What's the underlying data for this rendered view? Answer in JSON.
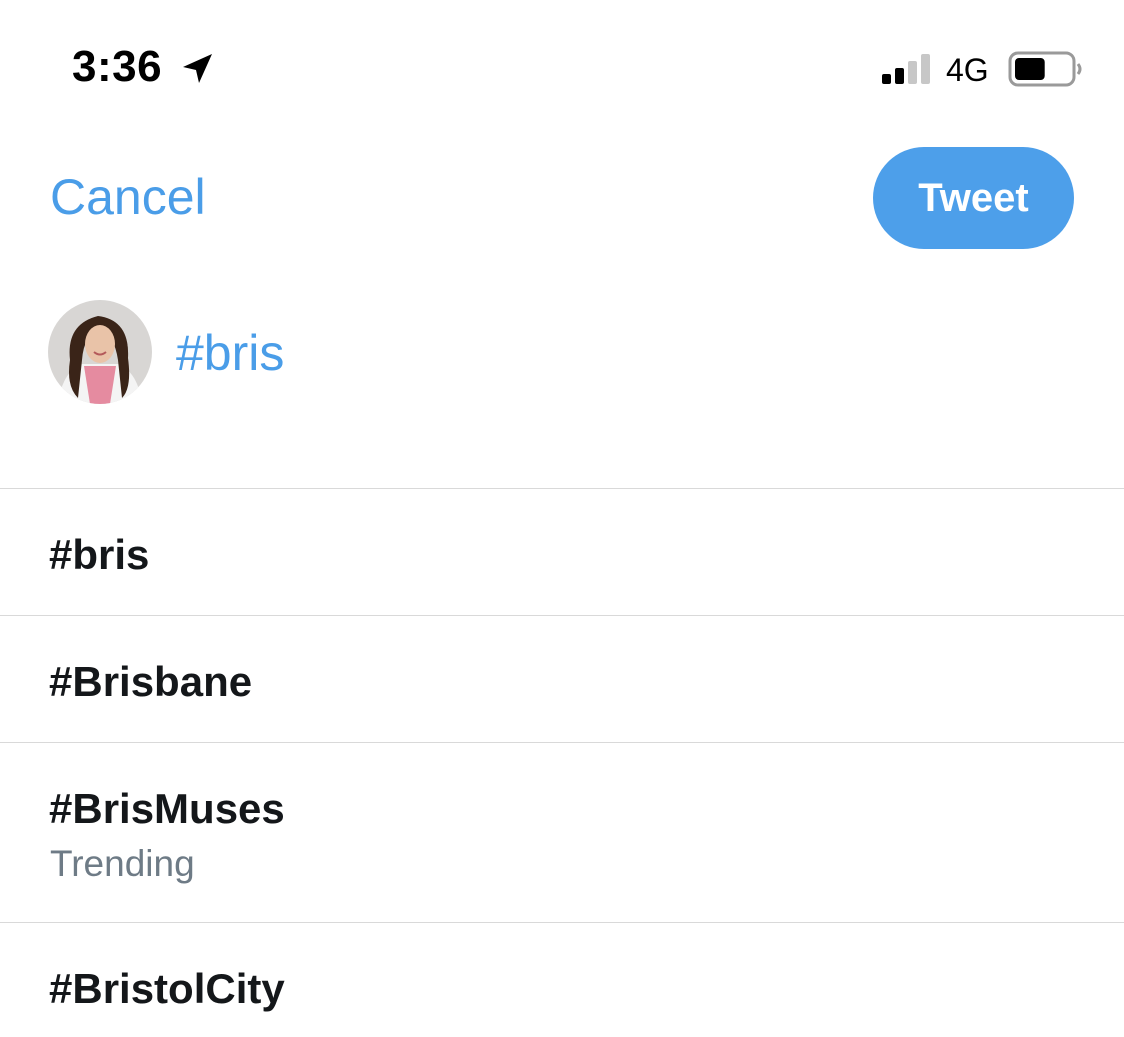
{
  "status_bar": {
    "time": "3:36",
    "network": "4G",
    "battery_level": 0.55
  },
  "header": {
    "cancel_label": "Cancel",
    "tweet_label": "Tweet"
  },
  "compose": {
    "text": "#bris"
  },
  "suggestions": [
    {
      "hashtag": "#bris",
      "subtitle": ""
    },
    {
      "hashtag": "#Brisbane",
      "subtitle": ""
    },
    {
      "hashtag": "#BrisMuses",
      "subtitle": "Trending"
    },
    {
      "hashtag": "#BristolCity",
      "subtitle": ""
    }
  ],
  "colors": {
    "accent": "#4d9fea",
    "link": "#4a9de8",
    "text": "#14171a",
    "secondary_text": "#6e7b86",
    "divider": "#d9d9d9"
  },
  "icons": [
    "location-arrow-icon",
    "cellular-signal-icon",
    "battery-icon"
  ]
}
